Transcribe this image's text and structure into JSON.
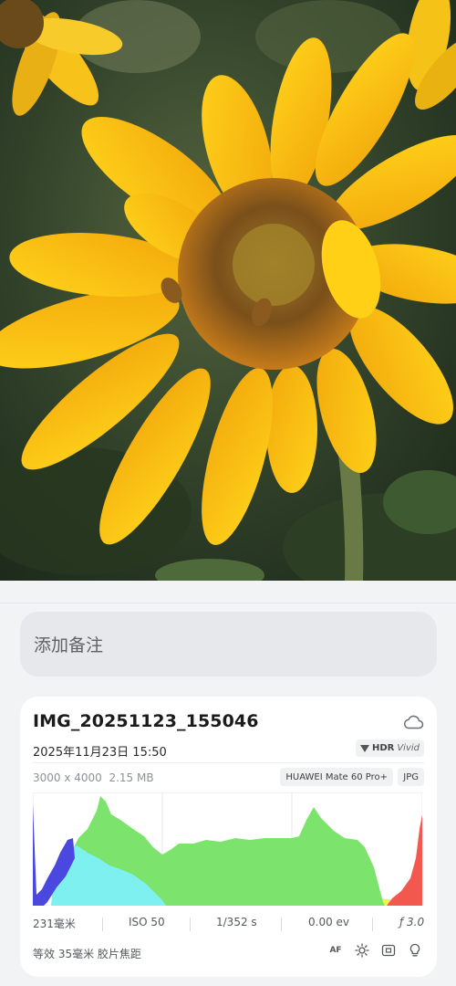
{
  "note": {
    "placeholder": "添加备注"
  },
  "info": {
    "file_name": "IMG_20251123_155046",
    "datetime": "2025年11月23日 15:50",
    "hdr_badge": {
      "hdr": "HDR",
      "vivid": "Vivid"
    },
    "resolution": "3000 x 4000",
    "file_size": "2.15 MB",
    "device": "HUAWEI Mate 60 Pro+",
    "format": "JPG",
    "exif": {
      "focal_length": "231毫米",
      "iso": "ISO 50",
      "shutter": "1/352 s",
      "exposure_bias": "0.00 ev",
      "aperture": "ƒ 3.0"
    },
    "lens_info": "等效 35毫米 胶片焦距",
    "mode_icons": [
      "af-icon",
      "flash-off-icon",
      "metering-icon",
      "white-balance-icon"
    ],
    "af_label": "AF"
  },
  "colors": {
    "background": "#f1f3f5",
    "card": "#ffffff",
    "histogram_green": "#7ce46c",
    "histogram_cyan": "#7ff0f0",
    "histogram_blue": "#4b48e0",
    "histogram_red": "#f2584e",
    "histogram_yellow": "#f2ef5c"
  }
}
